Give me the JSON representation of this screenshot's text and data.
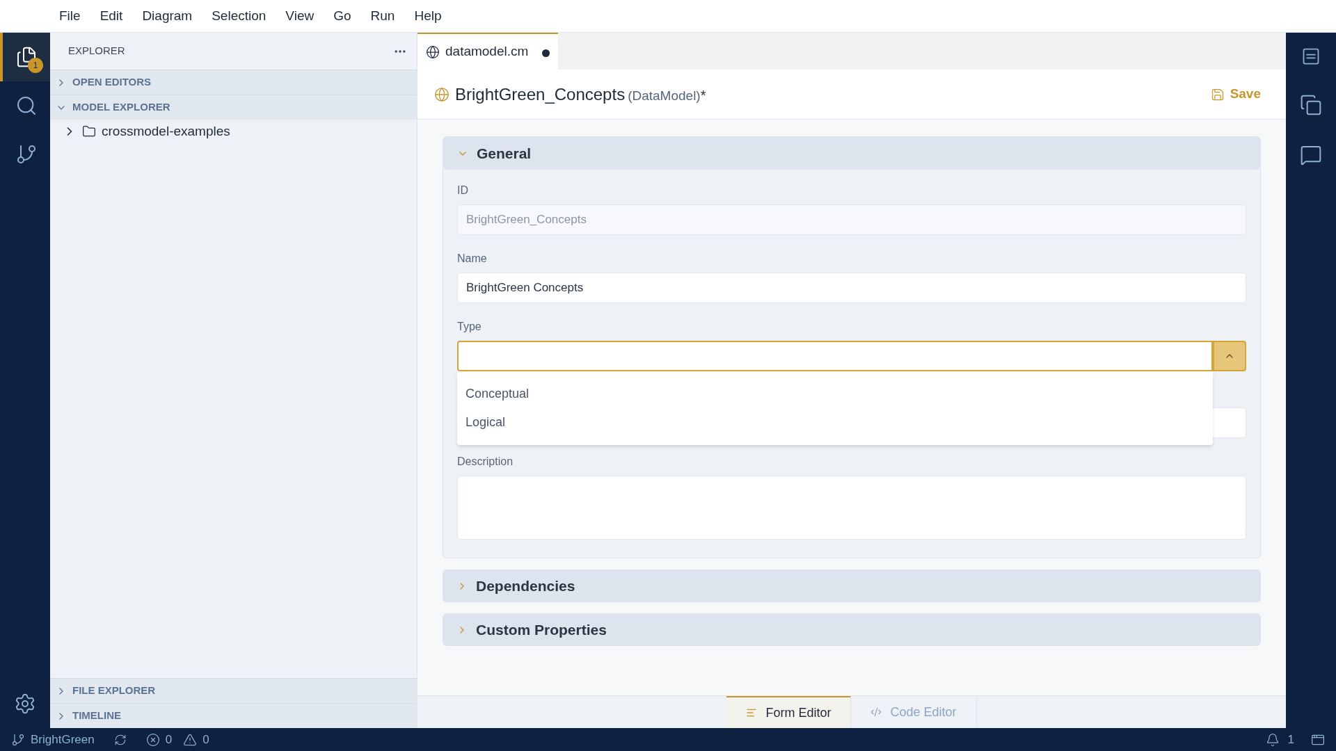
{
  "menu": [
    "File",
    "Edit",
    "Diagram",
    "Selection",
    "View",
    "Go",
    "Run",
    "Help"
  ],
  "activity_bar": {
    "items": [
      {
        "kind": "files",
        "selected": true,
        "badge": "1"
      },
      {
        "kind": "search",
        "selected": false
      },
      {
        "kind": "source-control",
        "selected": false
      }
    ]
  },
  "sidebar": {
    "title": "EXPLORER",
    "sections": [
      {
        "label": "OPEN EDITORS",
        "expanded": false
      },
      {
        "label": "MODEL EXPLORER",
        "expanded": true,
        "children": [
          {
            "label": "crossmodel-examples",
            "expanded": false
          }
        ]
      }
    ],
    "bottom_sections": [
      {
        "label": "FILE EXPLORER",
        "expanded": false
      },
      {
        "label": "TIMELINE",
        "expanded": false
      }
    ]
  },
  "editor_tab": {
    "label": "datamodel.cm",
    "modified": true
  },
  "header": {
    "title": "BrightGreen_Concepts",
    "subtitle": "(DataModel)",
    "dirty_mark": "*",
    "save": "Save"
  },
  "sections": [
    {
      "title": "General",
      "expanded": true,
      "fields": [
        {
          "kind": "text",
          "label": "ID",
          "value": "BrightGreen_Concepts",
          "disabled": true
        },
        {
          "kind": "text",
          "label": "Name",
          "value": "BrightGreen Concepts",
          "disabled": false
        },
        {
          "kind": "combo",
          "label": "Type",
          "expanded": true,
          "options": [
            "Conceptual",
            "Logical"
          ]
        },
        {
          "kind": "hidden-text"
        },
        {
          "kind": "textarea",
          "label": "Description"
        }
      ]
    },
    {
      "title": "Dependencies",
      "expanded": false
    },
    {
      "title": "Custom Properties",
      "expanded": false
    }
  ],
  "bottom_tabs": [
    {
      "kind": "form",
      "label": "Form Editor",
      "selected": true
    },
    {
      "kind": "code",
      "label": "Code Editor",
      "selected": false
    }
  ],
  "status_bar": {
    "branch": "BrightGreen",
    "errors": "0",
    "warnings": "0",
    "notifications": "1"
  }
}
